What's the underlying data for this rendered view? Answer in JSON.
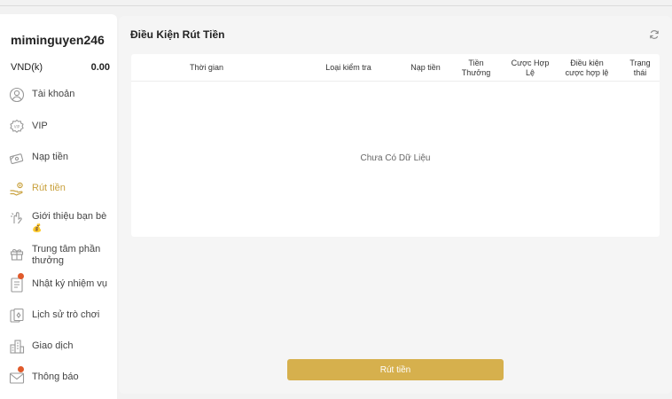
{
  "user": {
    "username": "miminguyen246"
  },
  "balance": {
    "currency": "VND(k)",
    "amount": "0.00"
  },
  "sidebar": {
    "items": [
      {
        "label": "Tài khoản",
        "icon": "user-icon"
      },
      {
        "label": "VIP",
        "icon": "vip-badge-icon"
      },
      {
        "label": "Nạp tiền",
        "icon": "deposit-icon"
      },
      {
        "label": "Rút tiền",
        "icon": "withdraw-icon",
        "active": true
      },
      {
        "label": "Giới thiệu bạn bè",
        "icon": "referral-icon",
        "emoji": "💰"
      },
      {
        "label": "Trung tâm phần thưởng",
        "icon": "gift-icon"
      },
      {
        "label": "Nhật ký nhiệm vụ",
        "icon": "task-log-icon",
        "notification": true
      },
      {
        "label": "Lịch sử trò chơi",
        "icon": "game-history-icon"
      },
      {
        "label": "Giao dịch",
        "icon": "transaction-icon"
      },
      {
        "label": "Thông báo",
        "icon": "mail-icon",
        "notification": true
      }
    ]
  },
  "main": {
    "title": "Điều Kiện Rút Tiền",
    "table": {
      "headers": [
        "Thời gian",
        "Loại kiểm tra",
        "Nạp tiền",
        "Tiền Thưởng",
        "Cược Hợp Lệ",
        "Điều kiện cược hợp lệ",
        "Trạng thái"
      ],
      "empty_text": "Chưa Có Dữ Liệu"
    },
    "withdraw_button": "Rút tiền"
  },
  "colors": {
    "accent": "#c9a13d",
    "button": "#d6b04d",
    "notification": "#e05a2b"
  }
}
